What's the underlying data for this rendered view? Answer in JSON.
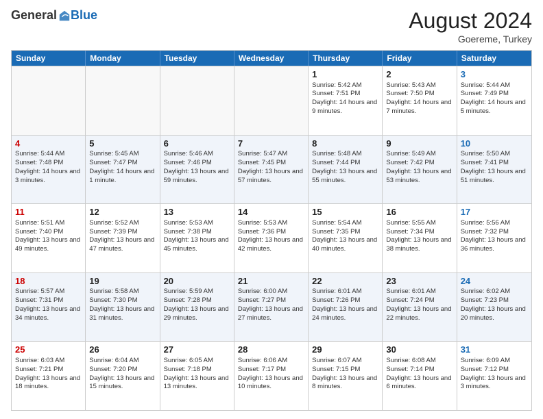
{
  "logo": {
    "general": "General",
    "blue": "Blue"
  },
  "header": {
    "month": "August 2024",
    "location": "Goereme, Turkey"
  },
  "days": [
    "Sunday",
    "Monday",
    "Tuesday",
    "Wednesday",
    "Thursday",
    "Friday",
    "Saturday"
  ],
  "weeks": [
    [
      {
        "day": "",
        "sunrise": "",
        "sunset": "",
        "daylight": "",
        "empty": true
      },
      {
        "day": "",
        "sunrise": "",
        "sunset": "",
        "daylight": "",
        "empty": true
      },
      {
        "day": "",
        "sunrise": "",
        "sunset": "",
        "daylight": "",
        "empty": true
      },
      {
        "day": "",
        "sunrise": "",
        "sunset": "",
        "daylight": "",
        "empty": true
      },
      {
        "day": "1",
        "sunrise": "Sunrise: 5:42 AM",
        "sunset": "Sunset: 7:51 PM",
        "daylight": "Daylight: 14 hours and 9 minutes.",
        "empty": false
      },
      {
        "day": "2",
        "sunrise": "Sunrise: 5:43 AM",
        "sunset": "Sunset: 7:50 PM",
        "daylight": "Daylight: 14 hours and 7 minutes.",
        "empty": false
      },
      {
        "day": "3",
        "sunrise": "Sunrise: 5:44 AM",
        "sunset": "Sunset: 7:49 PM",
        "daylight": "Daylight: 14 hours and 5 minutes.",
        "empty": false
      }
    ],
    [
      {
        "day": "4",
        "sunrise": "Sunrise: 5:44 AM",
        "sunset": "Sunset: 7:48 PM",
        "daylight": "Daylight: 14 hours and 3 minutes.",
        "empty": false
      },
      {
        "day": "5",
        "sunrise": "Sunrise: 5:45 AM",
        "sunset": "Sunset: 7:47 PM",
        "daylight": "Daylight: 14 hours and 1 minute.",
        "empty": false
      },
      {
        "day": "6",
        "sunrise": "Sunrise: 5:46 AM",
        "sunset": "Sunset: 7:46 PM",
        "daylight": "Daylight: 13 hours and 59 minutes.",
        "empty": false
      },
      {
        "day": "7",
        "sunrise": "Sunrise: 5:47 AM",
        "sunset": "Sunset: 7:45 PM",
        "daylight": "Daylight: 13 hours and 57 minutes.",
        "empty": false
      },
      {
        "day": "8",
        "sunrise": "Sunrise: 5:48 AM",
        "sunset": "Sunset: 7:44 PM",
        "daylight": "Daylight: 13 hours and 55 minutes.",
        "empty": false
      },
      {
        "day": "9",
        "sunrise": "Sunrise: 5:49 AM",
        "sunset": "Sunset: 7:42 PM",
        "daylight": "Daylight: 13 hours and 53 minutes.",
        "empty": false
      },
      {
        "day": "10",
        "sunrise": "Sunrise: 5:50 AM",
        "sunset": "Sunset: 7:41 PM",
        "daylight": "Daylight: 13 hours and 51 minutes.",
        "empty": false
      }
    ],
    [
      {
        "day": "11",
        "sunrise": "Sunrise: 5:51 AM",
        "sunset": "Sunset: 7:40 PM",
        "daylight": "Daylight: 13 hours and 49 minutes.",
        "empty": false
      },
      {
        "day": "12",
        "sunrise": "Sunrise: 5:52 AM",
        "sunset": "Sunset: 7:39 PM",
        "daylight": "Daylight: 13 hours and 47 minutes.",
        "empty": false
      },
      {
        "day": "13",
        "sunrise": "Sunrise: 5:53 AM",
        "sunset": "Sunset: 7:38 PM",
        "daylight": "Daylight: 13 hours and 45 minutes.",
        "empty": false
      },
      {
        "day": "14",
        "sunrise": "Sunrise: 5:53 AM",
        "sunset": "Sunset: 7:36 PM",
        "daylight": "Daylight: 13 hours and 42 minutes.",
        "empty": false
      },
      {
        "day": "15",
        "sunrise": "Sunrise: 5:54 AM",
        "sunset": "Sunset: 7:35 PM",
        "daylight": "Daylight: 13 hours and 40 minutes.",
        "empty": false
      },
      {
        "day": "16",
        "sunrise": "Sunrise: 5:55 AM",
        "sunset": "Sunset: 7:34 PM",
        "daylight": "Daylight: 13 hours and 38 minutes.",
        "empty": false
      },
      {
        "day": "17",
        "sunrise": "Sunrise: 5:56 AM",
        "sunset": "Sunset: 7:32 PM",
        "daylight": "Daylight: 13 hours and 36 minutes.",
        "empty": false
      }
    ],
    [
      {
        "day": "18",
        "sunrise": "Sunrise: 5:57 AM",
        "sunset": "Sunset: 7:31 PM",
        "daylight": "Daylight: 13 hours and 34 minutes.",
        "empty": false
      },
      {
        "day": "19",
        "sunrise": "Sunrise: 5:58 AM",
        "sunset": "Sunset: 7:30 PM",
        "daylight": "Daylight: 13 hours and 31 minutes.",
        "empty": false
      },
      {
        "day": "20",
        "sunrise": "Sunrise: 5:59 AM",
        "sunset": "Sunset: 7:28 PM",
        "daylight": "Daylight: 13 hours and 29 minutes.",
        "empty": false
      },
      {
        "day": "21",
        "sunrise": "Sunrise: 6:00 AM",
        "sunset": "Sunset: 7:27 PM",
        "daylight": "Daylight: 13 hours and 27 minutes.",
        "empty": false
      },
      {
        "day": "22",
        "sunrise": "Sunrise: 6:01 AM",
        "sunset": "Sunset: 7:26 PM",
        "daylight": "Daylight: 13 hours and 24 minutes.",
        "empty": false
      },
      {
        "day": "23",
        "sunrise": "Sunrise: 6:01 AM",
        "sunset": "Sunset: 7:24 PM",
        "daylight": "Daylight: 13 hours and 22 minutes.",
        "empty": false
      },
      {
        "day": "24",
        "sunrise": "Sunrise: 6:02 AM",
        "sunset": "Sunset: 7:23 PM",
        "daylight": "Daylight: 13 hours and 20 minutes.",
        "empty": false
      }
    ],
    [
      {
        "day": "25",
        "sunrise": "Sunrise: 6:03 AM",
        "sunset": "Sunset: 7:21 PM",
        "daylight": "Daylight: 13 hours and 18 minutes.",
        "empty": false
      },
      {
        "day": "26",
        "sunrise": "Sunrise: 6:04 AM",
        "sunset": "Sunset: 7:20 PM",
        "daylight": "Daylight: 13 hours and 15 minutes.",
        "empty": false
      },
      {
        "day": "27",
        "sunrise": "Sunrise: 6:05 AM",
        "sunset": "Sunset: 7:18 PM",
        "daylight": "Daylight: 13 hours and 13 minutes.",
        "empty": false
      },
      {
        "day": "28",
        "sunrise": "Sunrise: 6:06 AM",
        "sunset": "Sunset: 7:17 PM",
        "daylight": "Daylight: 13 hours and 10 minutes.",
        "empty": false
      },
      {
        "day": "29",
        "sunrise": "Sunrise: 6:07 AM",
        "sunset": "Sunset: 7:15 PM",
        "daylight": "Daylight: 13 hours and 8 minutes.",
        "empty": false
      },
      {
        "day": "30",
        "sunrise": "Sunrise: 6:08 AM",
        "sunset": "Sunset: 7:14 PM",
        "daylight": "Daylight: 13 hours and 6 minutes.",
        "empty": false
      },
      {
        "day": "31",
        "sunrise": "Sunrise: 6:09 AM",
        "sunset": "Sunset: 7:12 PM",
        "daylight": "Daylight: 13 hours and 3 minutes.",
        "empty": false
      }
    ]
  ]
}
